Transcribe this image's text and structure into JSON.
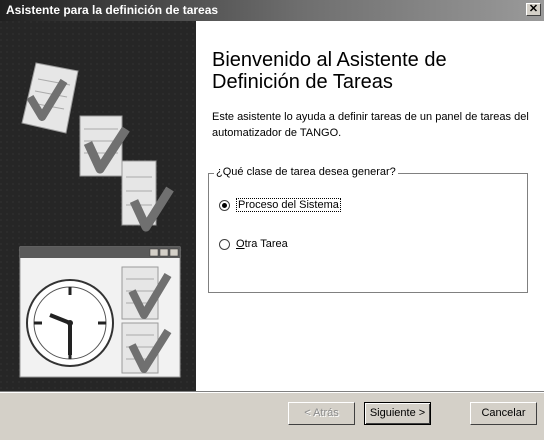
{
  "window": {
    "title": "Asistente para la definición de tareas",
    "close_glyph": "✕"
  },
  "content": {
    "heading": "Bienvenido al Asistente de Definición de Tareas",
    "intro": "Este asistente lo ayuda a definir tareas de un panel de tareas del automatizador de TANGO."
  },
  "task_group": {
    "legend": "¿Qué clase de tarea desea generar?",
    "options": [
      {
        "label": "Proceso del Sistema",
        "checked": true
      },
      {
        "label": "Otra Tarea",
        "checked": false
      }
    ]
  },
  "buttons": {
    "back": "< Atrás",
    "next": "Siguiente >",
    "cancel": "Cancelar"
  },
  "colors": {
    "panel_background": "#262626",
    "titlebar_start": "#202020",
    "titlebar_end": "#9a9a9a",
    "dialog_face": "#d4d0c8"
  },
  "icons": [
    "close-icon",
    "tasklist-check-icon",
    "clock-icon",
    "window-icon"
  ]
}
